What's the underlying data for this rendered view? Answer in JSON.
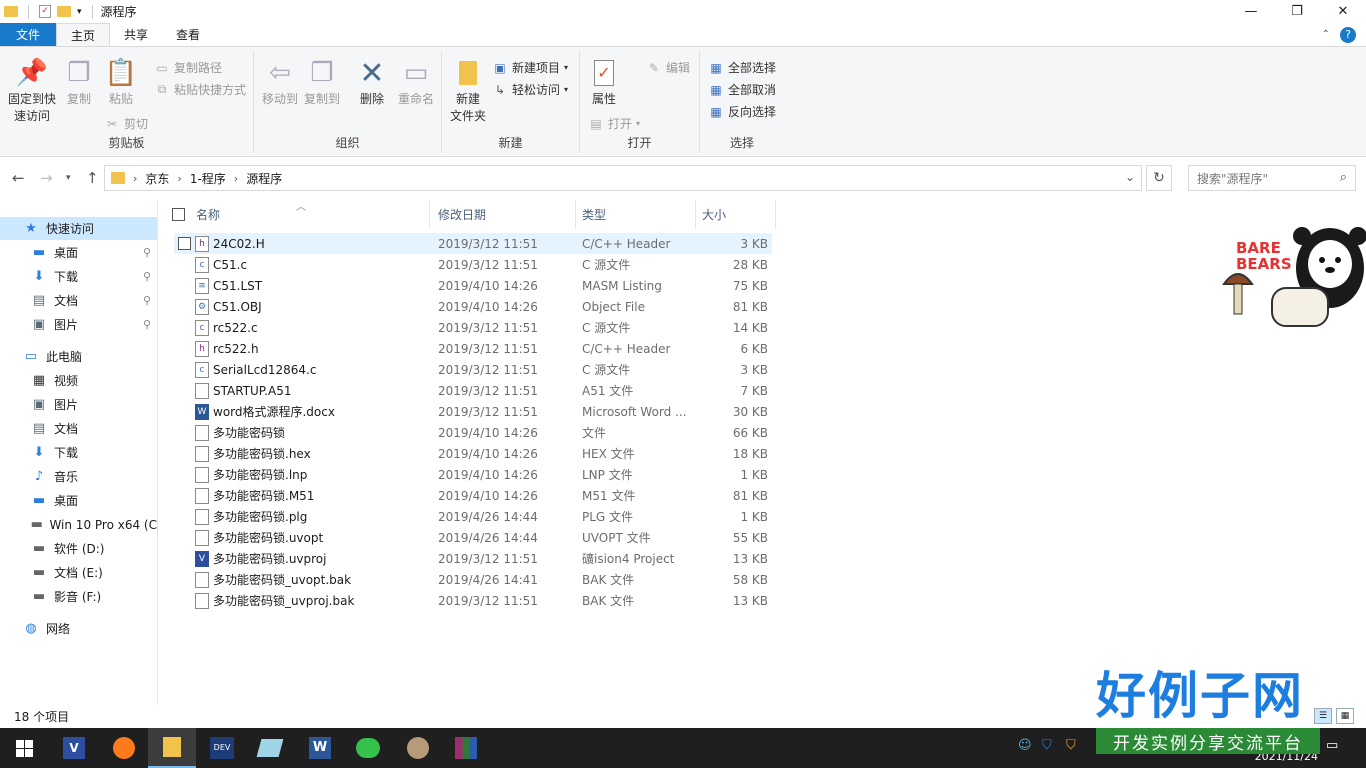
{
  "window": {
    "title": "源程序",
    "controls": [
      "—",
      "❐",
      "✕"
    ]
  },
  "ribbon_tabs": [
    {
      "label": "文件"
    },
    {
      "label": "主页"
    },
    {
      "label": "共享"
    },
    {
      "label": "查看"
    }
  ],
  "ribbon": {
    "clipboard": {
      "label": "剪贴板",
      "pin_quick_access": "固定到快\n速访问",
      "copy": "复制",
      "paste": "粘贴",
      "copy_path": "复制路径",
      "paste_shortcut": "粘贴快捷方式",
      "cut": "剪切"
    },
    "organize": {
      "label": "组织",
      "move_to": "移动到",
      "copy_to": "复制到",
      "delete": "删除",
      "rename": "重命名"
    },
    "new": {
      "label": "新建",
      "new_folder": "新建\n文件夹",
      "new_item": "新建项目",
      "easy_access": "轻松访问"
    },
    "open": {
      "label": "打开",
      "properties": "属性",
      "open": "打开",
      "edit": "编辑"
    },
    "select": {
      "label": "选择",
      "select_all": "全部选择",
      "select_none": "全部取消",
      "invert": "反向选择"
    }
  },
  "address": {
    "crumbs": [
      "京东",
      "1-程序",
      "源程序"
    ],
    "search_placeholder": "搜索\"源程序\""
  },
  "nav_pane": {
    "items": [
      {
        "label": "快速访问",
        "icon": "star-icon",
        "pinned": false
      },
      {
        "label": "桌面",
        "icon": "desktop-icon",
        "pinned": true
      },
      {
        "label": "下载",
        "icon": "download-icon",
        "pinned": true
      },
      {
        "label": "文档",
        "icon": "document-icon",
        "pinned": true
      },
      {
        "label": "图片",
        "icon": "picture-icon",
        "pinned": true
      },
      {
        "label": "此电脑",
        "icon": "computer-icon",
        "pinned": false
      },
      {
        "label": "视频",
        "icon": "video-icon",
        "pinned": false
      },
      {
        "label": "图片",
        "icon": "picture-icon",
        "pinned": false
      },
      {
        "label": "文档",
        "icon": "document-icon",
        "pinned": false
      },
      {
        "label": "下载",
        "icon": "download-icon",
        "pinned": false
      },
      {
        "label": "音乐",
        "icon": "music-icon",
        "pinned": false
      },
      {
        "label": "桌面",
        "icon": "desktop-icon",
        "pinned": false
      },
      {
        "label": "Win 10 Pro x64 (C",
        "icon": "drive-c-icon",
        "pinned": false
      },
      {
        "label": "软件 (D:)",
        "icon": "drive-icon",
        "pinned": false
      },
      {
        "label": "文档 (E:)",
        "icon": "drive-icon",
        "pinned": false
      },
      {
        "label": "影音 (F:)",
        "icon": "drive-icon",
        "pinned": false
      },
      {
        "label": "网络",
        "icon": "network-icon",
        "pinned": false
      }
    ]
  },
  "file_list": {
    "columns": [
      "名称",
      "修改日期",
      "类型",
      "大小"
    ],
    "rows": [
      {
        "name": "24C02.H",
        "date": "2019/3/12 11:51",
        "type": "C/C++ Header",
        "size": "3 KB",
        "icon": "h"
      },
      {
        "name": "C51.c",
        "date": "2019/3/12 11:51",
        "type": "C 源文件",
        "size": "28 KB",
        "icon": "c"
      },
      {
        "name": "C51.LST",
        "date": "2019/4/10 14:26",
        "type": "MASM Listing",
        "size": "75 KB",
        "icon": "txt"
      },
      {
        "name": "C51.OBJ",
        "date": "2019/4/10 14:26",
        "type": "Object File",
        "size": "81 KB",
        "icon": "obj"
      },
      {
        "name": "rc522.c",
        "date": "2019/3/12 11:51",
        "type": "C 源文件",
        "size": "14 KB",
        "icon": "c"
      },
      {
        "name": "rc522.h",
        "date": "2019/3/12 11:51",
        "type": "C/C++ Header",
        "size": "6 KB",
        "icon": "h"
      },
      {
        "name": "SerialLcd12864.c",
        "date": "2019/3/12 11:51",
        "type": "C 源文件",
        "size": "3 KB",
        "icon": "c"
      },
      {
        "name": "STARTUP.A51",
        "date": "2019/3/12 11:51",
        "type": "A51 文件",
        "size": "7 KB",
        "icon": "blank"
      },
      {
        "name": "word格式源程序.docx",
        "date": "2019/3/12 11:51",
        "type": "Microsoft Word ...",
        "size": "30 KB",
        "icon": "word"
      },
      {
        "name": "多功能密码锁",
        "date": "2019/4/10 14:26",
        "type": "文件",
        "size": "66 KB",
        "icon": "blank"
      },
      {
        "name": "多功能密码锁.hex",
        "date": "2019/4/10 14:26",
        "type": "HEX 文件",
        "size": "18 KB",
        "icon": "blank"
      },
      {
        "name": "多功能密码锁.lnp",
        "date": "2019/4/10 14:26",
        "type": "LNP 文件",
        "size": "1 KB",
        "icon": "blank"
      },
      {
        "name": "多功能密码锁.M51",
        "date": "2019/4/10 14:26",
        "type": "M51 文件",
        "size": "81 KB",
        "icon": "blank"
      },
      {
        "name": "多功能密码锁.plg",
        "date": "2019/4/26 14:44",
        "type": "PLG 文件",
        "size": "1 KB",
        "icon": "blank"
      },
      {
        "name": "多功能密码锁.uvopt",
        "date": "2019/4/26 14:44",
        "type": "UVOPT 文件",
        "size": "55 KB",
        "icon": "blank"
      },
      {
        "name": "多功能密码锁.uvproj",
        "date": "2019/3/12 11:51",
        "type": "礦ision4 Project",
        "size": "13 KB",
        "icon": "keil"
      },
      {
        "name": "多功能密码锁_uvopt.bak",
        "date": "2019/4/26 14:41",
        "type": "BAK 文件",
        "size": "58 KB",
        "icon": "blank"
      },
      {
        "name": "多功能密码锁_uvproj.bak",
        "date": "2019/3/12 11:51",
        "type": "BAK 文件",
        "size": "13 KB",
        "icon": "blank"
      }
    ]
  },
  "status": {
    "item_count": "18 个项目"
  },
  "taskbar": {
    "clock": "2021/11/24"
  },
  "watermark": {
    "brand": "好例子网",
    "tagline": "开发实例分享交流平台",
    "sticker_text": "BARE BEARS"
  }
}
